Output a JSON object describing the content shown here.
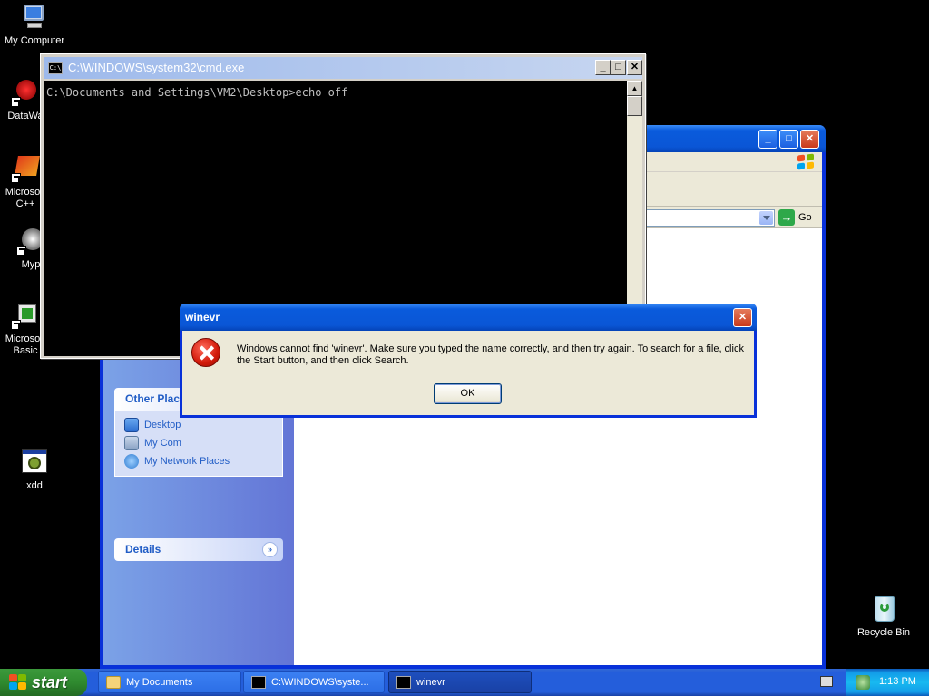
{
  "desktop": {
    "icons": [
      {
        "label": "My Computer"
      },
      {
        "label": "DataWa"
      },
      {
        "label": "Microsoft\nC++"
      },
      {
        "label": "Myp"
      },
      {
        "label": "Microsoft\nBasic"
      },
      {
        "label": "xdd"
      },
      {
        "label": "Recycle Bin"
      }
    ]
  },
  "explorer": {
    "address_go_label": "Go",
    "other_places": {
      "header": "Other Plac",
      "items": [
        {
          "label": "Desktop",
          "icon": "desktop-icon"
        },
        {
          "label": "My Com",
          "icon": "my-computer-icon"
        },
        {
          "label": "My Network Places",
          "icon": "network-places-icon"
        }
      ]
    },
    "details": {
      "header": "Details"
    }
  },
  "cmd": {
    "title": "C:\\WINDOWS\\system32\\cmd.exe",
    "icon_text": "C:\\",
    "output": "C:\\Documents and Settings\\VM2\\Desktop>echo off"
  },
  "dialog": {
    "title": "winevr",
    "message": "Windows cannot find 'winevr'. Make sure you typed the name correctly, and then try again. To search for a file, click the Start button, and then click Search.",
    "ok_label": "OK"
  },
  "taskbar": {
    "start_label": "start",
    "buttons": [
      {
        "label": "My Documents",
        "active": false
      },
      {
        "label": "C:\\WINDOWS\\syste...",
        "active": false
      },
      {
        "label": "winevr",
        "active": true
      }
    ],
    "clock": "1:13 PM"
  },
  "colors": {
    "xp_blue": "#0a56d6",
    "start_green": "#2f8a2f",
    "error_red": "#d21a0a",
    "sidebar_blue": "#7ba2e7"
  }
}
